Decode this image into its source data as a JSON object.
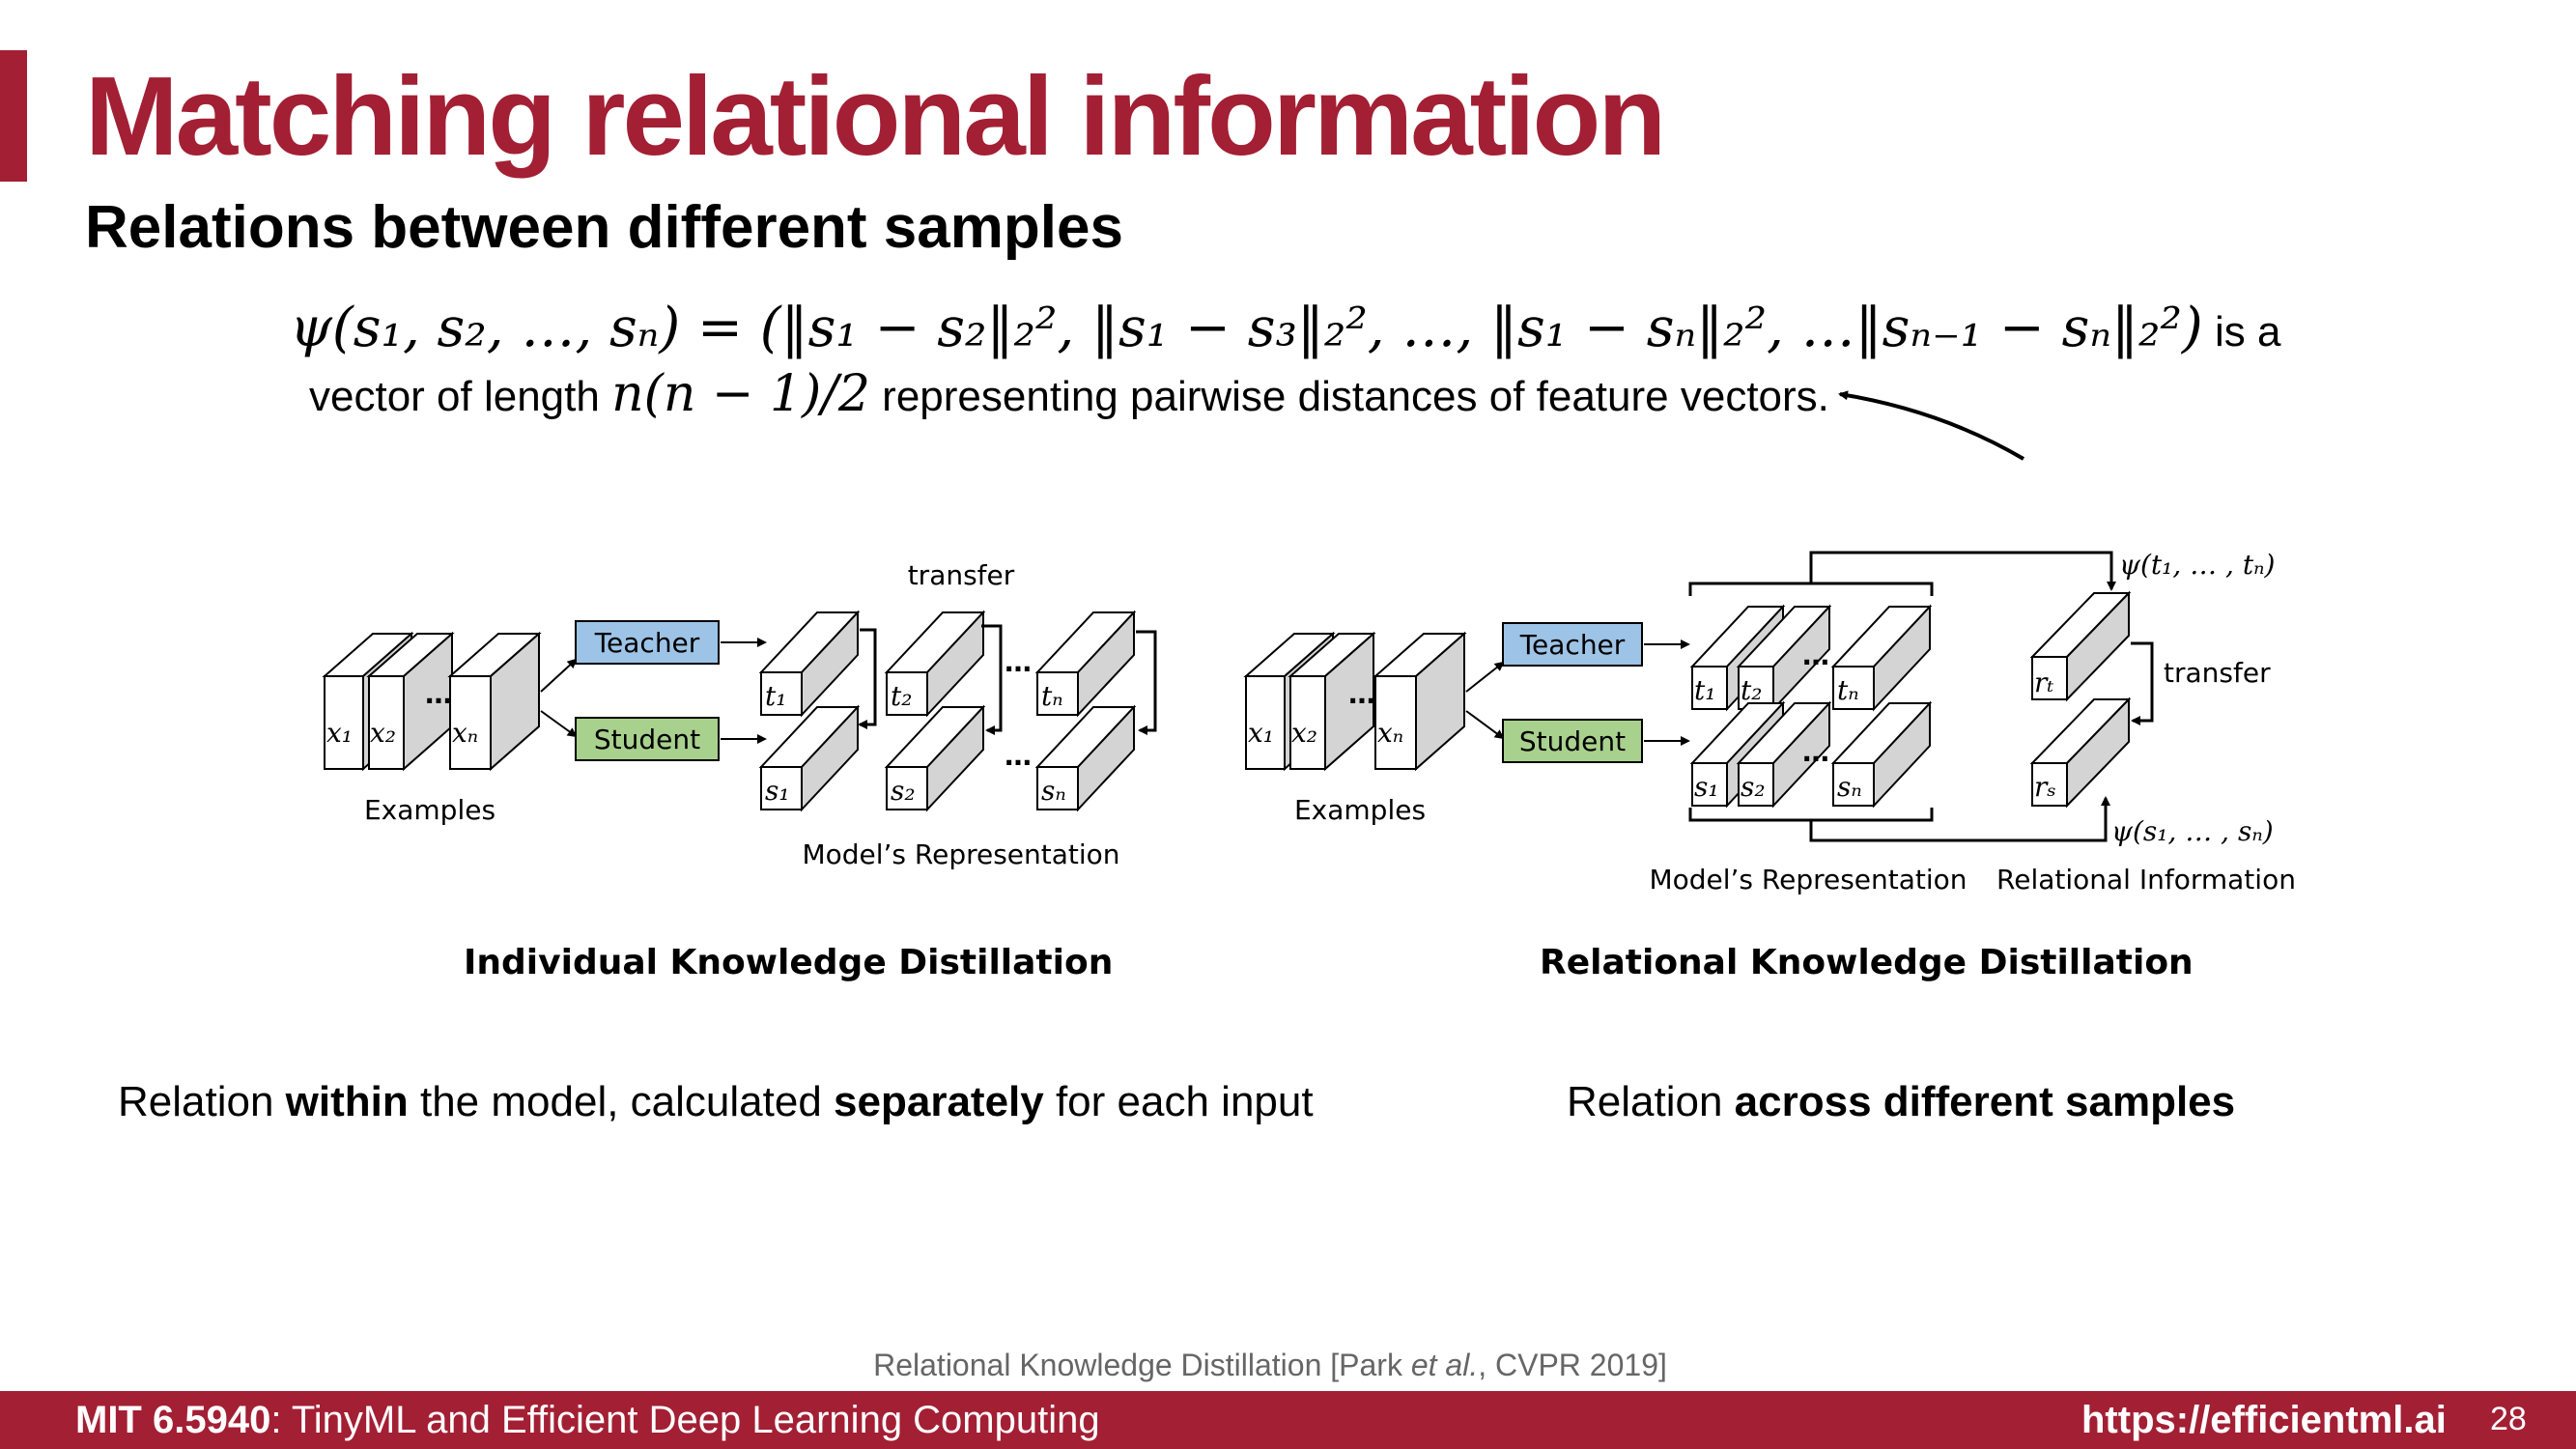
{
  "slide": {
    "title": "Matching relational information",
    "subtitle": "Relations between different samples"
  },
  "formula": {
    "expression": "ψ(s₁, s₂, …, sₙ) = (‖s₁ − s₂‖₂², ‖s₁ − s₃‖₂², …, ‖s₁ − sₙ‖₂², …‖sₙ₋₁ − sₙ‖₂²)",
    "tail": " is a",
    "line2_pre": "vector of length ",
    "line2_math": "n(n − 1)/2",
    "line2_post": " representing pairwise distances of feature vectors."
  },
  "left_diagram": {
    "examples_label": "Examples",
    "teacher_label": "Teacher",
    "student_label": "Student",
    "transfer_label": "transfer",
    "representation_label": "Model’s Representation",
    "inputs": [
      "x₁",
      "x₂",
      "xₙ"
    ],
    "teacher_outputs": [
      "t₁",
      "t₂",
      "tₙ"
    ],
    "student_outputs": [
      "s₁",
      "s₂",
      "sₙ"
    ],
    "ellipsis": "…",
    "caption": "Individual Knowledge Distillation"
  },
  "right_diagram": {
    "examples_label": "Examples",
    "teacher_label": "Teacher",
    "student_label": "Student",
    "transfer_label": "transfer",
    "representation_label": "Model’s Representation",
    "relational_label": "Relational Information",
    "psi_t": "ψ(t₁, … , tₙ)",
    "psi_s": "ψ(s₁, … , sₙ)",
    "r_t": "rₜ",
    "r_s": "rₛ",
    "inputs": [
      "x₁",
      "x₂",
      "xₙ"
    ],
    "teacher_outputs": [
      "t₁",
      "t₂",
      "tₙ"
    ],
    "student_outputs": [
      "s₁",
      "s₂",
      "sₙ"
    ],
    "ellipsis": "…",
    "caption": "Relational Knowledge Distillation"
  },
  "relations": {
    "left_pre": "Relation ",
    "left_bold1": "within",
    "left_mid": " the model, calculated ",
    "left_bold2": "separately",
    "left_post": " for each input",
    "right_pre": "Relation ",
    "right_bold": "across different samples"
  },
  "citation": {
    "pre": "Relational Knowledge Distillation [Park ",
    "etal": "et al.",
    "post": ", CVPR 2019]"
  },
  "footer": {
    "course_bold": "MIT 6.5940",
    "course_rest": ": TinyML and Efficient Deep Learning Computing",
    "url": "https://efficientml.ai",
    "page": "28"
  },
  "colors": {
    "brand": "#a31f34",
    "teacher_fill": "#9dc3e6",
    "student_fill": "#a9d18e"
  }
}
